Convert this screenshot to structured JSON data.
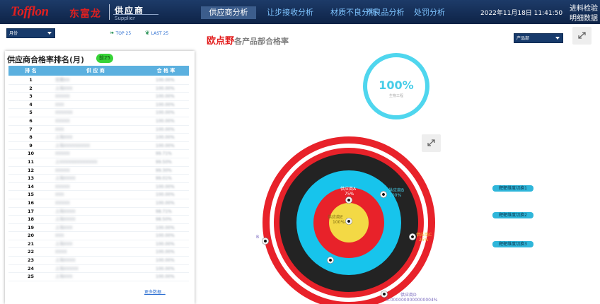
{
  "header": {
    "logo_text": "Tofflon",
    "logo_cn": "东富龙",
    "title": "供应商",
    "subtitle": "Supplier",
    "tabs": [
      {
        "label": "供应商分析",
        "active": true
      },
      {
        "label": "让步接收分析",
        "active": false
      },
      {
        "label": "材质不良分析",
        "active": false
      },
      {
        "label": "不良品分析",
        "active": false
      },
      {
        "label": "处罚分析",
        "active": false
      }
    ],
    "datetime": "2022年11月18日  11:41:50",
    "links": [
      "进料检验",
      "明细数据"
    ],
    "active_tab_color": "#3c5d8c"
  },
  "filters": {
    "period": "月份",
    "top_label": "TOP 25",
    "last_label": "LAST 25",
    "department": "产品部"
  },
  "left_panel": {
    "title": "供应商合格率排名",
    "period_tag": "(月)",
    "badge": "前25",
    "columns": [
      "排 名",
      "供 应 商",
      "合 格 率"
    ],
    "rows": [
      {
        "rank": "1",
        "supplier": "无锡XX",
        "rate": "100.00%"
      },
      {
        "rank": "2",
        "supplier": "上海XXX",
        "rate": "100.00%"
      },
      {
        "rank": "3",
        "supplier": "XXXXX",
        "rate": "100.00%"
      },
      {
        "rank": "4",
        "supplier": "XXX",
        "rate": "100.00%"
      },
      {
        "rank": "5",
        "supplier": "XXXXXX",
        "rate": "100.00%"
      },
      {
        "rank": "6",
        "supplier": "XXXXX",
        "rate": "100.00%"
      },
      {
        "rank": "7",
        "supplier": "XXX",
        "rate": "100.00%"
      },
      {
        "rank": "8",
        "supplier": "上海XXX",
        "rate": "100.00%"
      },
      {
        "rank": "9",
        "supplier": "上海XXXXXXXXX",
        "rate": "100.00%"
      },
      {
        "rank": "10",
        "supplier": "XXXXX",
        "rate": "99.71%"
      },
      {
        "rank": "11",
        "supplier": "上XXXXXXXXXXXXX",
        "rate": "99.50%"
      },
      {
        "rank": "12",
        "supplier": "XXXXX",
        "rate": "99.30%"
      },
      {
        "rank": "13",
        "supplier": "上海XXXX",
        "rate": "99.01%"
      },
      {
        "rank": "14",
        "supplier": "XXXXX",
        "rate": "100.00%"
      },
      {
        "rank": "15",
        "supplier": "XXX",
        "rate": "100.00%"
      },
      {
        "rank": "16",
        "supplier": "XXXXX",
        "rate": "100.00%"
      },
      {
        "rank": "17",
        "supplier": "上海XXXX",
        "rate": "98.71%"
      },
      {
        "rank": "18",
        "supplier": "上海XXXX",
        "rate": "98.50%"
      },
      {
        "rank": "19",
        "supplier": "上海XXX",
        "rate": "100.00%"
      },
      {
        "rank": "20",
        "supplier": "XXX",
        "rate": "100.00%"
      },
      {
        "rank": "21",
        "supplier": "上海XXX",
        "rate": "100.00%"
      },
      {
        "rank": "22",
        "supplier": "XXXX",
        "rate": "100.00%"
      },
      {
        "rank": "23",
        "supplier": "上海XXXX",
        "rate": "100.00%"
      },
      {
        "rank": "24",
        "supplier": "上海XXXXX",
        "rate": "100.00%"
      },
      {
        "rank": "25",
        "supplier": "上海XXX",
        "rate": "100.00%"
      }
    ],
    "more_link": "更多数据..."
  },
  "main": {
    "title_red": "欧点野",
    "title_gray": "各产品部合格率",
    "gauge_value": "100%",
    "gauge_label": "生物工程",
    "target_labels": [
      {
        "text": "供应商A",
        "sub": "75%"
      },
      {
        "text": "供应商B",
        "sub": "100%"
      },
      {
        "text": "供应商C",
        "sub": "25%"
      },
      {
        "text": "供应商D",
        "sub": "5.0000000000000004%"
      },
      {
        "text": "供应商E",
        "sub": "100%"
      },
      {
        "text": "B",
        "sub": ""
      }
    ],
    "switch_buttons": [
      "靶靶维度切换1",
      "靶靶维度切换2",
      "靶靶维度切换3"
    ],
    "colors": {
      "outer": "#e8222a",
      "black": "#232323",
      "blue": "#17c4ec",
      "red": "#e8222a",
      "yellow": "#f3d945"
    }
  }
}
